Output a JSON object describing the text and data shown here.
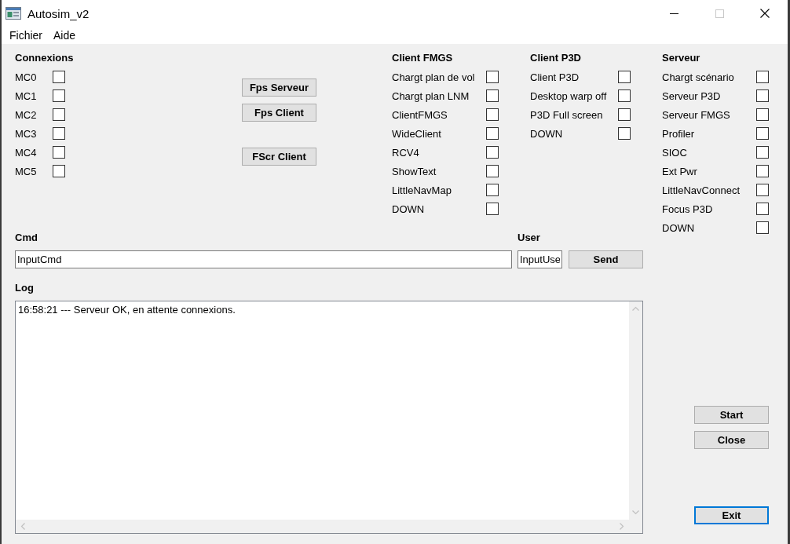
{
  "window": {
    "title": "Autosim_v2"
  },
  "menu": [
    {
      "label": "Fichier"
    },
    {
      "label": "Aide"
    }
  ],
  "connexions": {
    "title": "Connexions",
    "items": [
      {
        "label": "MC0",
        "checked": false
      },
      {
        "label": "MC1",
        "checked": false
      },
      {
        "label": "MC2",
        "checked": false
      },
      {
        "label": "MC3",
        "checked": false
      },
      {
        "label": "MC4",
        "checked": false
      },
      {
        "label": "MC5",
        "checked": false
      }
    ]
  },
  "fps_buttons": [
    {
      "label": "Fps Serveur"
    },
    {
      "label": "Fps Client"
    },
    {
      "label": "FScr Client"
    }
  ],
  "client_fmgs": {
    "title": "Client FMGS",
    "items": [
      {
        "label": "Chargt plan de vol",
        "checked": false
      },
      {
        "label": "Chargt plan LNM",
        "checked": false
      },
      {
        "label": "ClientFMGS",
        "checked": false
      },
      {
        "label": "WideClient",
        "checked": false
      },
      {
        "label": "RCV4",
        "checked": false
      },
      {
        "label": "ShowText",
        "checked": false
      },
      {
        "label": "LittleNavMap",
        "checked": false
      },
      {
        "label": "DOWN",
        "checked": false
      }
    ]
  },
  "client_p3d": {
    "title": "Client P3D",
    "items": [
      {
        "label": "Client P3D",
        "checked": false
      },
      {
        "label": "Desktop warp off",
        "checked": false
      },
      {
        "label": "P3D Full screen",
        "checked": false
      },
      {
        "label": "DOWN",
        "checked": false
      }
    ]
  },
  "serveur": {
    "title": "Serveur",
    "items": [
      {
        "label": "Chargt scénario",
        "checked": false
      },
      {
        "label": "Serveur P3D",
        "checked": false
      },
      {
        "label": "Serveur FMGS",
        "checked": false
      },
      {
        "label": "Profiler",
        "checked": false
      },
      {
        "label": "SIOC",
        "checked": false
      },
      {
        "label": "Ext Pwr",
        "checked": false
      },
      {
        "label": "LittleNavConnect",
        "checked": false
      },
      {
        "label": "Focus P3D",
        "checked": false
      },
      {
        "label": "DOWN",
        "checked": false
      }
    ]
  },
  "cmd": {
    "label": "Cmd",
    "value": "InputCmd"
  },
  "user": {
    "label": "User",
    "value": "InputUse"
  },
  "send_button": {
    "label": "Send"
  },
  "log": {
    "label": "Log",
    "lines": [
      "16:58:21 --- Serveur OK, en attente connexions."
    ]
  },
  "actions": [
    {
      "label": "Start",
      "focused": false
    },
    {
      "label": "Close",
      "focused": false
    },
    {
      "label": "Exit",
      "focused": true
    }
  ]
}
